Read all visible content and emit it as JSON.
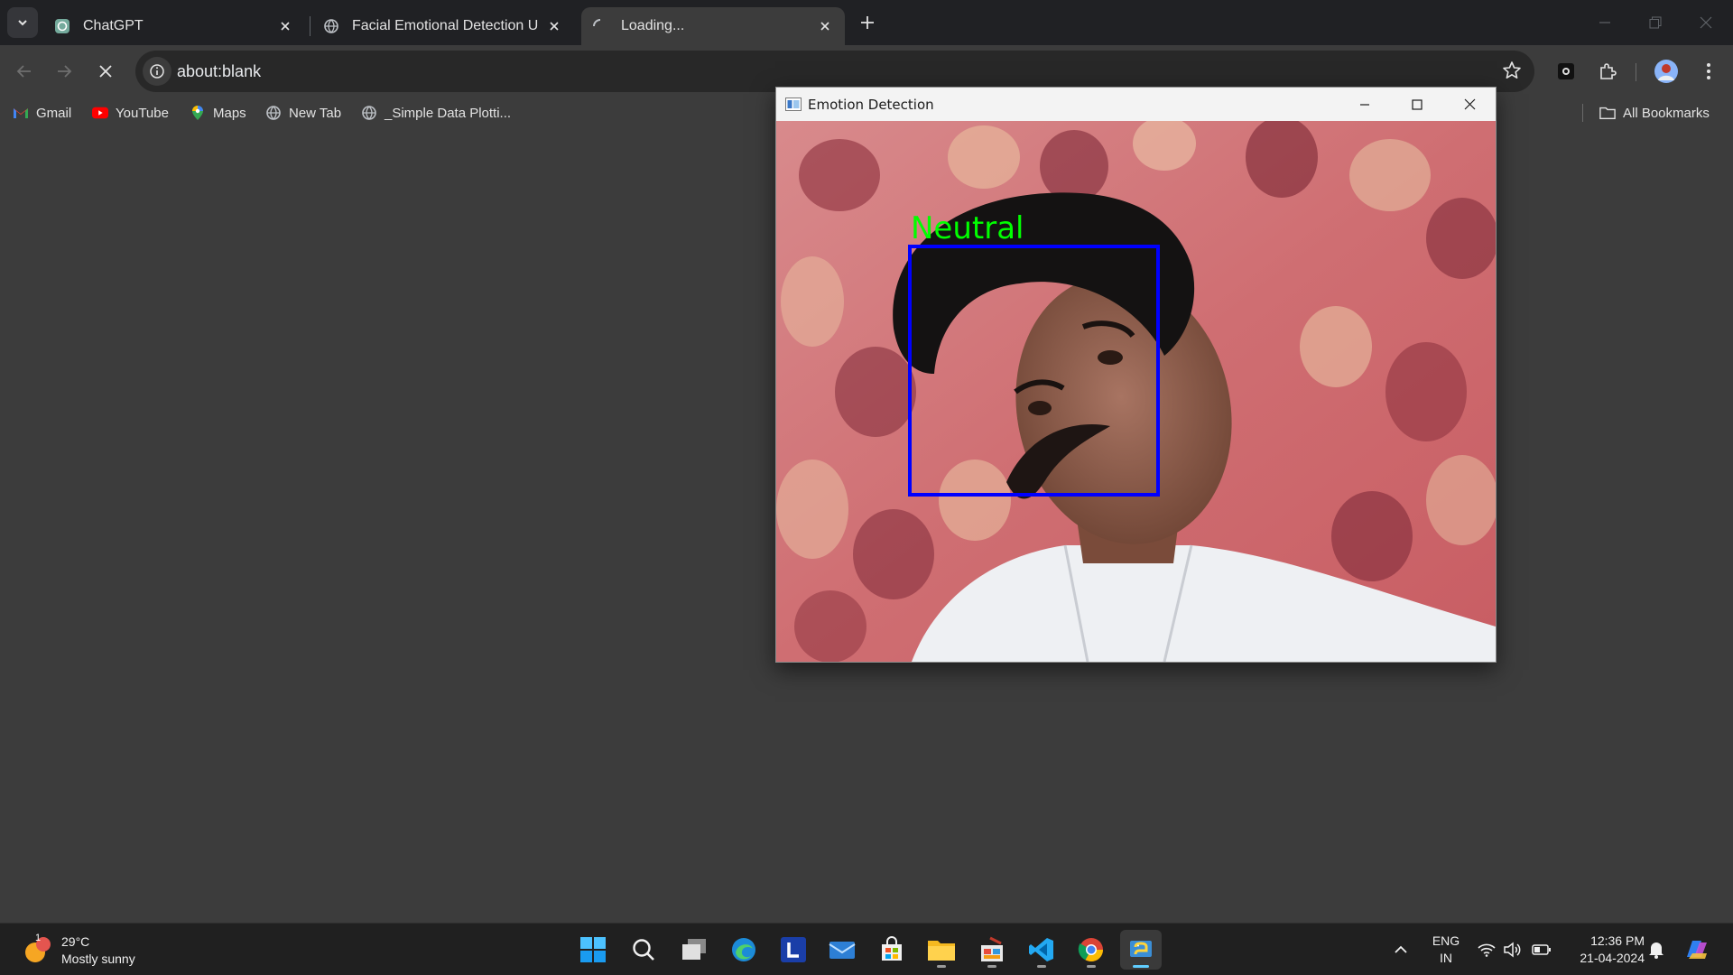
{
  "browser": {
    "tabs": [
      {
        "title": "ChatGPT",
        "favicon": "chatgpt-icon"
      },
      {
        "title": "Facial Emotional Detection Usi",
        "favicon": "globe-icon"
      },
      {
        "title": "Loading...",
        "favicon": "loading-spinner-icon",
        "active": true
      }
    ],
    "address": "about:blank",
    "bookmarks": [
      {
        "label": "Gmail",
        "icon": "gmail-icon"
      },
      {
        "label": "YouTube",
        "icon": "youtube-icon"
      },
      {
        "label": "Maps",
        "icon": "maps-icon"
      },
      {
        "label": "New Tab",
        "icon": "globe-icon"
      },
      {
        "label": "_Simple Data Plotti...",
        "icon": "globe-icon"
      }
    ],
    "all_bookmarks_label": "All Bookmarks"
  },
  "detection_window": {
    "title": "Emotion Detection",
    "emotion_label": "Neutral",
    "label_color": "#00ff00",
    "box_color": "#0000ff"
  },
  "taskbar": {
    "weather": {
      "temp": "29°C",
      "condition": "Mostly sunny",
      "badge": "1"
    },
    "apps": [
      "start-icon",
      "search-icon",
      "task-view-icon",
      "edge-icon",
      "l-app-icon",
      "mail-icon",
      "store-icon",
      "file-explorer-icon",
      "paint-icon",
      "vscode-icon",
      "chrome-icon",
      "python-icon"
    ],
    "lang_line1": "ENG",
    "lang_line2": "IN",
    "time": "12:36 PM",
    "date": "21-04-2024"
  },
  "colors": {
    "titlebar": "#202124",
    "toolbar": "#3c3c3c",
    "accent": "#60cdff"
  }
}
